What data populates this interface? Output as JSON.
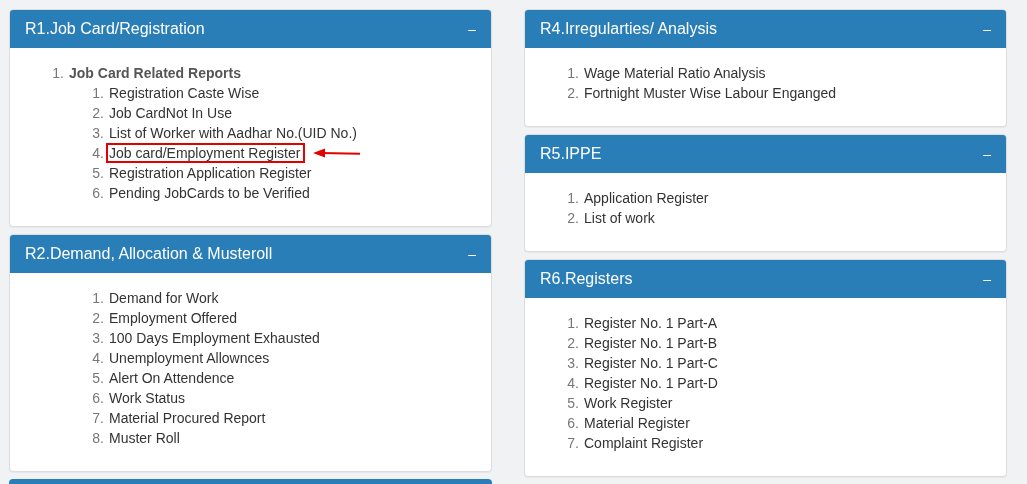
{
  "left_column": [
    {
      "kind": "panel",
      "title": "R1.Job Card/Registration",
      "toggle": "–",
      "indented": false,
      "items": [
        {
          "number": "1.",
          "label": "Job Card Related Reports",
          "bold": true,
          "highlighted": false,
          "children": [
            {
              "number": "1.",
              "label": "Registration Caste Wise",
              "highlighted": false
            },
            {
              "number": "2.",
              "label": "Job CardNot In Use",
              "highlighted": false
            },
            {
              "number": "3.",
              "label": "List of Worker with Aadhar No.(UID No.)",
              "highlighted": false
            },
            {
              "number": "4.",
              "label": "Job card/Employment Register",
              "highlighted": true
            },
            {
              "number": "5.",
              "label": "Registration Application Register",
              "highlighted": false
            },
            {
              "number": "6.",
              "label": "Pending JobCards to be Verified",
              "highlighted": false
            }
          ]
        }
      ]
    },
    {
      "kind": "panel",
      "title": "R2.Demand, Allocation & Musteroll",
      "toggle": "–",
      "indented": true,
      "items": [
        {
          "number": "1.",
          "label": "Demand for Work",
          "highlighted": false
        },
        {
          "number": "2.",
          "label": "Employment Offered",
          "highlighted": false
        },
        {
          "number": "3.",
          "label": "100 Days Employment Exhausted",
          "highlighted": false
        },
        {
          "number": "4.",
          "label": "Unemployment Allownces",
          "highlighted": false
        },
        {
          "number": "5.",
          "label": "Alert On Attendence",
          "highlighted": false
        },
        {
          "number": "6.",
          "label": "Work Status",
          "highlighted": false
        },
        {
          "number": "7.",
          "label": "Material Procured Report",
          "highlighted": false
        },
        {
          "number": "8.",
          "label": "Muster Roll",
          "highlighted": false
        }
      ]
    },
    {
      "kind": "clipped"
    }
  ],
  "right_column": [
    {
      "kind": "panel",
      "title": "R4.Irregularties/ Analysis",
      "toggle": "–",
      "indented": false,
      "items": [
        {
          "number": "1.",
          "label": "Wage Material Ratio Analysis",
          "highlighted": false
        },
        {
          "number": "2.",
          "label": "Fortnight Muster Wise Labour Enganged",
          "highlighted": false
        }
      ]
    },
    {
      "kind": "panel",
      "title": "R5.IPPE",
      "toggle": "–",
      "indented": false,
      "items": [
        {
          "number": "1.",
          "label": "Application Register",
          "highlighted": false
        },
        {
          "number": "2.",
          "label": "List of work",
          "highlighted": false
        }
      ]
    },
    {
      "kind": "panel",
      "title": "R6.Registers",
      "toggle": "–",
      "indented": false,
      "items": [
        {
          "number": "1.",
          "label": "Register No. 1 Part-A",
          "highlighted": false
        },
        {
          "number": "2.",
          "label": "Register No. 1 Part-B",
          "highlighted": false
        },
        {
          "number": "3.",
          "label": "Register No. 1 Part-C",
          "highlighted": false
        },
        {
          "number": "4.",
          "label": "Register No. 1 Part-D",
          "highlighted": false
        },
        {
          "number": "5.",
          "label": "Work Register",
          "highlighted": false
        },
        {
          "number": "6.",
          "label": "Material Register",
          "highlighted": false
        },
        {
          "number": "7.",
          "label": "Complaint Register",
          "highlighted": false
        }
      ]
    }
  ]
}
